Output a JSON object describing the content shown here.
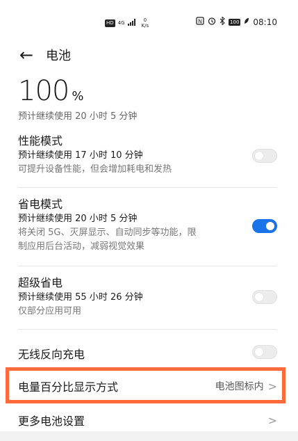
{
  "status_bar": {
    "hd": "HD",
    "network": "4G",
    "net_speed_value": "0",
    "net_speed_unit": "K/s",
    "nfc": "N",
    "battery": "100",
    "time": "08:10"
  },
  "header": {
    "back_icon": "←",
    "title": "电池"
  },
  "battery": {
    "percent": "100",
    "unit": "%",
    "estimate": "预计继续使用 20 小时 5 分钟"
  },
  "modes": [
    {
      "title": "性能模式",
      "estimate": "预计继续使用 17 小时 10 分钟",
      "desc": [
        "可提升设备性能，但会增加耗电和发热"
      ],
      "enabled": false
    },
    {
      "title": "省电模式",
      "estimate": "预计继续使用 20 小时 5 分钟",
      "desc": [
        "将关闭 5G、灭屏显示、自动同步等功能，限",
        "制应用后台活动，减弱视觉效果"
      ],
      "enabled": true
    },
    {
      "title": "超级省电",
      "estimate": "预计继续使用 55 小时 26 分钟",
      "desc": [
        "仅部分应用可用"
      ],
      "enabled": false
    }
  ],
  "reverse_charge": {
    "label": "无线反向充电",
    "enabled": false
  },
  "percent_display": {
    "label": "电量百分比显示方式",
    "value": "电池图标内",
    "chevron": ">"
  },
  "more_settings": {
    "label": "更多电池设置",
    "chevron": ">"
  },
  "colors": {
    "accent": "#1a73e8",
    "highlight": "#ff6a3d"
  }
}
